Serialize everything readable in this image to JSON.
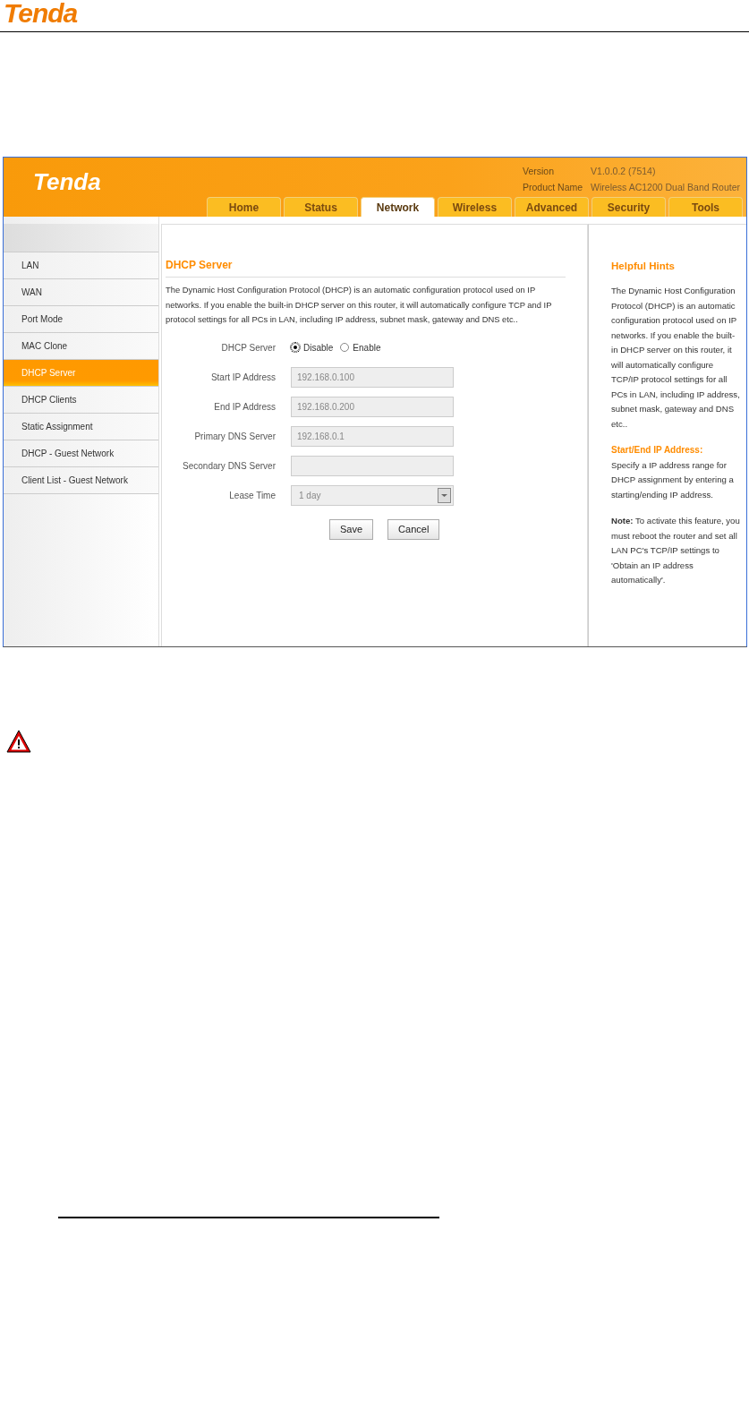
{
  "page_header": {
    "logo": "Tenda"
  },
  "router_ui": {
    "logo": "Tenda",
    "info": [
      {
        "label": "Version",
        "value": "V1.0.0.2 (7514)"
      },
      {
        "label": "Product Name",
        "value": "Wireless AC1200 Dual Band Router"
      }
    ],
    "tabs": [
      {
        "label": "Home",
        "selected": false
      },
      {
        "label": "Status",
        "selected": false
      },
      {
        "label": "Network",
        "selected": true
      },
      {
        "label": "Wireless",
        "selected": false
      },
      {
        "label": "Advanced",
        "selected": false
      },
      {
        "label": "Security",
        "selected": false
      },
      {
        "label": "Tools",
        "selected": false
      }
    ],
    "sidebar": {
      "items": [
        {
          "label": "LAN",
          "selected": false
        },
        {
          "label": "WAN",
          "selected": false
        },
        {
          "label": "Port Mode",
          "selected": false
        },
        {
          "label": "MAC Clone",
          "selected": false
        },
        {
          "label": "DHCP Server",
          "selected": true
        },
        {
          "label": "DHCP Clients",
          "selected": false
        },
        {
          "label": "Static Assignment",
          "selected": false
        },
        {
          "label": "DHCP - Guest Network",
          "selected": false
        },
        {
          "label": "Client List - Guest Network",
          "selected": false
        }
      ]
    },
    "content": {
      "title": "DHCP Server",
      "description": "The Dynamic Host Configuration Protocol (DHCP) is an automatic configuration protocol used on IP networks. If you enable the built-in DHCP server on this router, it will automatically configure TCP and IP protocol settings for all PCs in LAN, including IP address, subnet mask, gateway and DNS etc..",
      "fields": [
        {
          "kind": "radio",
          "label": "DHCP Server",
          "options": [
            {
              "label": "Disable",
              "selected": true
            },
            {
              "label": "Enable",
              "selected": false
            }
          ]
        },
        {
          "kind": "text",
          "label": "Start IP Address",
          "value": "192.168.0.100",
          "disabled": true
        },
        {
          "kind": "text",
          "label": "End IP Address",
          "value": "192.168.0.200",
          "disabled": true
        },
        {
          "kind": "text",
          "label": "Primary DNS Server",
          "value": "192.168.0.1",
          "disabled": true
        },
        {
          "kind": "text",
          "label": "Secondary DNS Server",
          "disabled": true
        },
        {
          "kind": "select",
          "label": "Lease Time",
          "value": "1 day",
          "disabled": true
        }
      ],
      "buttons": [
        "Save",
        "Cancel"
      ]
    },
    "hints": {
      "title": "Helpful Hints",
      "sections": [
        {
          "kind": "plain",
          "text": "The Dynamic Host Configuration Protocol (DHCP) is an automatic configuration protocol used on IP networks. If you enable the built-in DHCP server on this router, it will automatically configure TCP/IP protocol settings for all PCs in LAN, including IP address, subnet mask, gateway and DNS etc.."
        },
        {
          "kind": "headed",
          "heading": "Start/End IP Address:",
          "text": "Specify a IP address range for DHCP assignment by entering a starting/ending IP address."
        },
        {
          "kind": "plain",
          "text": "**Note:** To activate this feature, you must reboot the router and set all LAN PC's TCP/IP settings to 'Obtain an IP address automatically'."
        }
      ]
    }
  }
}
